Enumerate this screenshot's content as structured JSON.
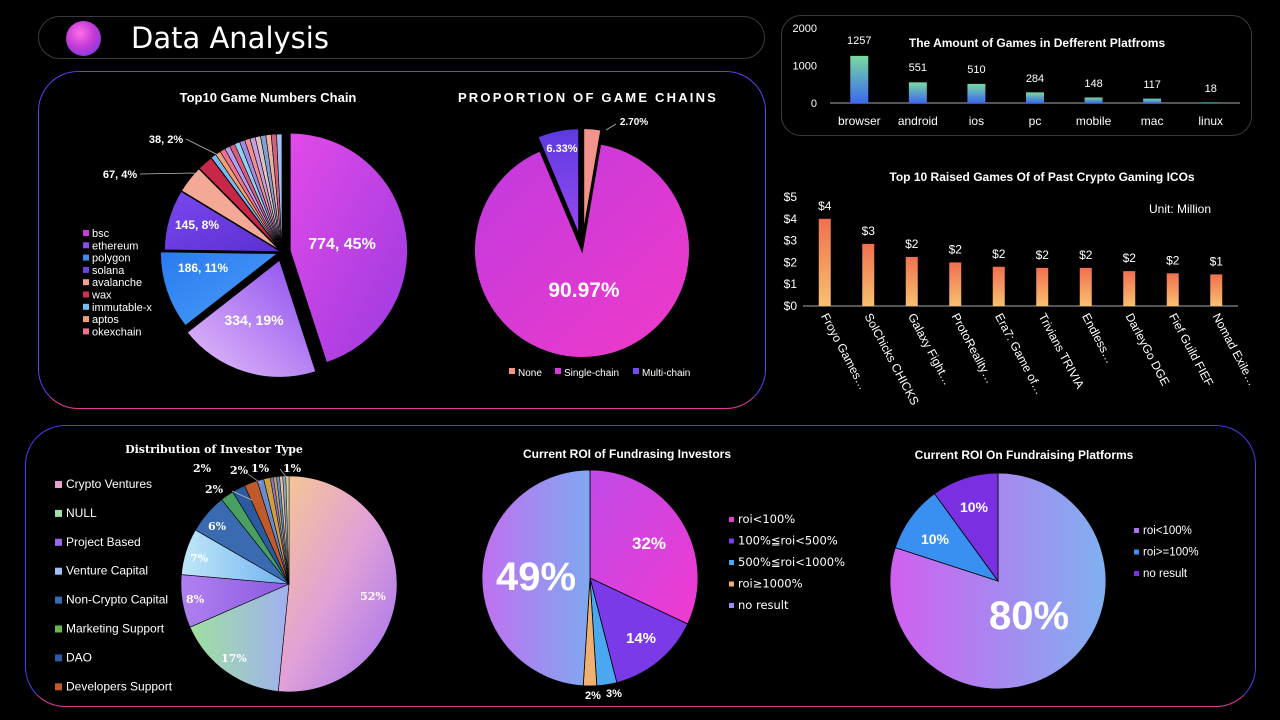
{
  "header": {
    "title": "Data Analysis"
  },
  "colors": {
    "accent_purple": "#6a3cf0",
    "accent_pink": "#e23a9c"
  },
  "chart_data": [
    {
      "id": "chain_pie",
      "type": "pie",
      "title": "Top10 Game Numbers Chain",
      "slice_labels": [
        {
          "label": "774, 45%",
          "value": 774
        },
        {
          "label": "334, 19%",
          "value": 334
        },
        {
          "label": "186, 11%",
          "value": 186
        },
        {
          "label": "145, 8%",
          "value": 145
        },
        {
          "label": "67, 4%",
          "value": 67
        },
        {
          "label": "38, 2%",
          "value": 38
        }
      ],
      "legend": [
        "bsc",
        "ethereum",
        "polygon",
        "solana",
        "avalanche",
        "wax",
        "immutable-x",
        "aptos",
        "okexchain"
      ],
      "legend_colors": [
        "#c83ae0",
        "#8a4af0",
        "#3a8af0",
        "#6a40e0",
        "#f0a090",
        "#d03050",
        "#70c0f0",
        "#f0a070",
        "#f07090"
      ]
    },
    {
      "id": "proportion_pie",
      "type": "pie",
      "title": "PROPORTION OF GAME CHAINS",
      "categories": [
        "None",
        "Single-chain",
        "Multi-chain"
      ],
      "values": [
        2.7,
        90.97,
        6.33
      ],
      "labels": [
        "2.70%",
        "90.97%",
        "6.33%"
      ],
      "colors": [
        "#f3928a",
        "#d83ae0",
        "#7a4af0"
      ]
    },
    {
      "id": "platform_bar",
      "type": "bar",
      "title": "The Amount of Games in Defferent Platfroms",
      "categories": [
        "browser",
        "android",
        "ios",
        "pc",
        "mobile",
        "mac",
        "linux"
      ],
      "values": [
        1257,
        551,
        510,
        284,
        148,
        117,
        18
      ],
      "ylim": [
        0,
        2000
      ],
      "yticks": [
        "0",
        "1000",
        "2000"
      ]
    },
    {
      "id": "ico_bar",
      "type": "bar",
      "title": "Top 10 Raised Games Of of Past Crypto Gaming ICOs",
      "unit": "Unit: Million",
      "categories": [
        "Froyo Games…",
        "SolChicks CHICKS",
        "Galaxy Fight…",
        "ProtoReality…",
        "Era7: Game of…",
        "Trivians TRIVIA",
        "Endless…",
        "DarleyGo DGE",
        "Fief Guild FIEF",
        "Nomad Exile…"
      ],
      "values": [
        4.0,
        2.85,
        2.25,
        2.0,
        1.8,
        1.75,
        1.75,
        1.6,
        1.5,
        1.45
      ],
      "data_labels": [
        "$4",
        "$3",
        "$2",
        "$2",
        "$2",
        "$2",
        "$2",
        "$2",
        "$2",
        "$1"
      ],
      "ylim": [
        0,
        5
      ],
      "yticks": [
        "$0",
        "$1",
        "$2",
        "$3",
        "$4",
        "$5"
      ]
    },
    {
      "id": "investor_pie",
      "type": "pie",
      "title": "Distribution of Investor Type",
      "slices": [
        {
          "label": "52%",
          "value": 52
        },
        {
          "label": "17%",
          "value": 17
        },
        {
          "label": "8%",
          "value": 8
        },
        {
          "label": "7%",
          "value": 7
        },
        {
          "label": "6%",
          "value": 6
        },
        {
          "label": "2%",
          "value": 2
        },
        {
          "label": "2%",
          "value": 2
        },
        {
          "label": "2%",
          "value": 2
        },
        {
          "label": "1%",
          "value": 1
        },
        {
          "label": "1%",
          "value": 1
        }
      ],
      "legend": [
        "Crypto Ventures",
        "NULL",
        "Project Based",
        "Venture Capital",
        "Non-Crypto Capital",
        "Marketing Support",
        "DAO",
        "Developers Support"
      ],
      "legend_colors": [
        "#e8a0d0",
        "#a0e0b0",
        "#9a6ae8",
        "#a0c0f0",
        "#3a6ab0",
        "#6ab84a",
        "#2a5aa0",
        "#c05a2a"
      ]
    },
    {
      "id": "roi_investors_pie",
      "type": "pie",
      "title": "Current ROI of Fundrasing Investors",
      "categories": [
        "roi<100%",
        "100%≦roi<500%",
        "500%≦roi<1000%",
        "roi≥1000%",
        "no result"
      ],
      "values": [
        32,
        14,
        3,
        2,
        49
      ],
      "labels": [
        "32%",
        "14%",
        "3%",
        "2%",
        "49%"
      ],
      "colors": [
        "#e040d0",
        "#7a3ae8",
        "#4aa8f0",
        "#f0b070",
        "#a08af0"
      ]
    },
    {
      "id": "roi_platforms_pie",
      "type": "pie",
      "title": "Current ROI On Fundraising Platforms",
      "categories": [
        "roi<100%",
        "roi>=100%",
        "no result"
      ],
      "values": [
        80,
        10,
        10
      ],
      "labels": [
        "80%",
        "10%",
        "10%"
      ],
      "colors": [
        "#b070f0",
        "#3a90f0",
        "#7a30e0"
      ]
    }
  ]
}
